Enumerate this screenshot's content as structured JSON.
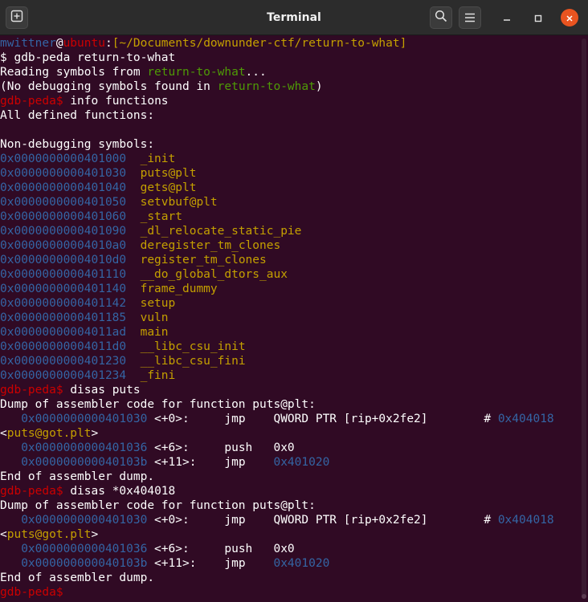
{
  "window": {
    "title": "Terminal"
  },
  "colors": {
    "default": "#ffffff",
    "user": "#3465a4",
    "host": "#cc0000",
    "path": "#c4a000",
    "prompt": "#cc0000",
    "green": "#4e9a06",
    "addr": "#3465a4",
    "sym": "#c4a000",
    "gdbaddr": "#3465a4"
  },
  "icons": {
    "new_tab": "new-tab-icon",
    "search": "search-icon",
    "menu": "hamburger-menu-icon",
    "minimize": "minimize-icon",
    "maximize": "maximize-icon",
    "close": "close-icon"
  },
  "terminal_lines": [
    [
      {
        "t": "mwittner",
        "c": "user"
      },
      {
        "t": "@",
        "c": "default"
      },
      {
        "t": "ubuntu",
        "c": "host"
      },
      {
        "t": ":",
        "c": "default"
      },
      {
        "t": "[~/Documents/downunder-ctf/return-to-what]",
        "c": "path"
      }
    ],
    [
      {
        "t": "$ gdb-peda return-to-what",
        "c": "default"
      }
    ],
    [
      {
        "t": "Reading symbols from ",
        "c": "default"
      },
      {
        "t": "return-to-what",
        "c": "green"
      },
      {
        "t": "...",
        "c": "default"
      }
    ],
    [
      {
        "t": "(No debugging symbols found in ",
        "c": "default"
      },
      {
        "t": "return-to-what",
        "c": "green"
      },
      {
        "t": ")",
        "c": "default"
      }
    ],
    [
      {
        "t": "gdb-peda$ ",
        "c": "prompt"
      },
      {
        "t": "info functions",
        "c": "default"
      }
    ],
    [
      {
        "t": "All defined functions:",
        "c": "default"
      }
    ],
    [
      {
        "t": "",
        "c": "default"
      }
    ],
    [
      {
        "t": "Non-debugging symbols:",
        "c": "default"
      }
    ],
    [
      {
        "t": "0x0000000000401000",
        "c": "addr"
      },
      {
        "t": "  _init",
        "c": "sym"
      }
    ],
    [
      {
        "t": "0x0000000000401030",
        "c": "addr"
      },
      {
        "t": "  puts@plt",
        "c": "sym"
      }
    ],
    [
      {
        "t": "0x0000000000401040",
        "c": "addr"
      },
      {
        "t": "  gets@plt",
        "c": "sym"
      }
    ],
    [
      {
        "t": "0x0000000000401050",
        "c": "addr"
      },
      {
        "t": "  setvbuf@plt",
        "c": "sym"
      }
    ],
    [
      {
        "t": "0x0000000000401060",
        "c": "addr"
      },
      {
        "t": "  _start",
        "c": "sym"
      }
    ],
    [
      {
        "t": "0x0000000000401090",
        "c": "addr"
      },
      {
        "t": "  _dl_relocate_static_pie",
        "c": "sym"
      }
    ],
    [
      {
        "t": "0x00000000004010a0",
        "c": "addr"
      },
      {
        "t": "  deregister_tm_clones",
        "c": "sym"
      }
    ],
    [
      {
        "t": "0x00000000004010d0",
        "c": "addr"
      },
      {
        "t": "  register_tm_clones",
        "c": "sym"
      }
    ],
    [
      {
        "t": "0x0000000000401110",
        "c": "addr"
      },
      {
        "t": "  __do_global_dtors_aux",
        "c": "sym"
      }
    ],
    [
      {
        "t": "0x0000000000401140",
        "c": "addr"
      },
      {
        "t": "  frame_dummy",
        "c": "sym"
      }
    ],
    [
      {
        "t": "0x0000000000401142",
        "c": "addr"
      },
      {
        "t": "  setup",
        "c": "sym"
      }
    ],
    [
      {
        "t": "0x0000000000401185",
        "c": "addr"
      },
      {
        "t": "  vuln",
        "c": "sym"
      }
    ],
    [
      {
        "t": "0x00000000004011ad",
        "c": "addr"
      },
      {
        "t": "  main",
        "c": "sym"
      }
    ],
    [
      {
        "t": "0x00000000004011d0",
        "c": "addr"
      },
      {
        "t": "  __libc_csu_init",
        "c": "sym"
      }
    ],
    [
      {
        "t": "0x0000000000401230",
        "c": "addr"
      },
      {
        "t": "  __libc_csu_fini",
        "c": "sym"
      }
    ],
    [
      {
        "t": "0x0000000000401234",
        "c": "addr"
      },
      {
        "t": "  _fini",
        "c": "sym"
      }
    ],
    [
      {
        "t": "gdb-peda$ ",
        "c": "prompt"
      },
      {
        "t": "disas puts",
        "c": "default"
      }
    ],
    [
      {
        "t": "Dump of assembler code for function puts@plt:",
        "c": "default"
      }
    ],
    [
      {
        "t": "   0x0000000000401030",
        "c": "addr"
      },
      {
        "t": " <+0>:     jmp    QWORD PTR [rip+0x2fe2]        # ",
        "c": "default"
      },
      {
        "t": "0x404018",
        "c": "addr"
      }
    ],
    [
      {
        "t": "<",
        "c": "default"
      },
      {
        "t": "puts@got.plt",
        "c": "sym"
      },
      {
        "t": ">",
        "c": "default"
      }
    ],
    [
      {
        "t": "   0x0000000000401036",
        "c": "addr"
      },
      {
        "t": " <+6>:     push   0x0",
        "c": "default"
      }
    ],
    [
      {
        "t": "   0x000000000040103b",
        "c": "addr"
      },
      {
        "t": " <+11>:    jmp    ",
        "c": "default"
      },
      {
        "t": "0x401020",
        "c": "addr"
      }
    ],
    [
      {
        "t": "End of assembler dump.",
        "c": "default"
      }
    ],
    [
      {
        "t": "gdb-peda$ ",
        "c": "prompt"
      },
      {
        "t": "disas *0x404018",
        "c": "default"
      }
    ],
    [
      {
        "t": "Dump of assembler code for function puts@plt:",
        "c": "default"
      }
    ],
    [
      {
        "t": "   0x0000000000401030",
        "c": "addr"
      },
      {
        "t": " <+0>:     jmp    QWORD PTR [rip+0x2fe2]        # ",
        "c": "default"
      },
      {
        "t": "0x404018",
        "c": "addr"
      }
    ],
    [
      {
        "t": "<",
        "c": "default"
      },
      {
        "t": "puts@got.plt",
        "c": "sym"
      },
      {
        "t": ">",
        "c": "default"
      }
    ],
    [
      {
        "t": "   0x0000000000401036",
        "c": "addr"
      },
      {
        "t": " <+6>:     push   0x0",
        "c": "default"
      }
    ],
    [
      {
        "t": "   0x000000000040103b",
        "c": "addr"
      },
      {
        "t": " <+11>:    jmp    ",
        "c": "default"
      },
      {
        "t": "0x401020",
        "c": "addr"
      }
    ],
    [
      {
        "t": "End of assembler dump.",
        "c": "default"
      }
    ],
    [
      {
        "t": "gdb-peda$ ",
        "c": "prompt"
      },
      {
        "t": "",
        "c": "default"
      }
    ]
  ]
}
